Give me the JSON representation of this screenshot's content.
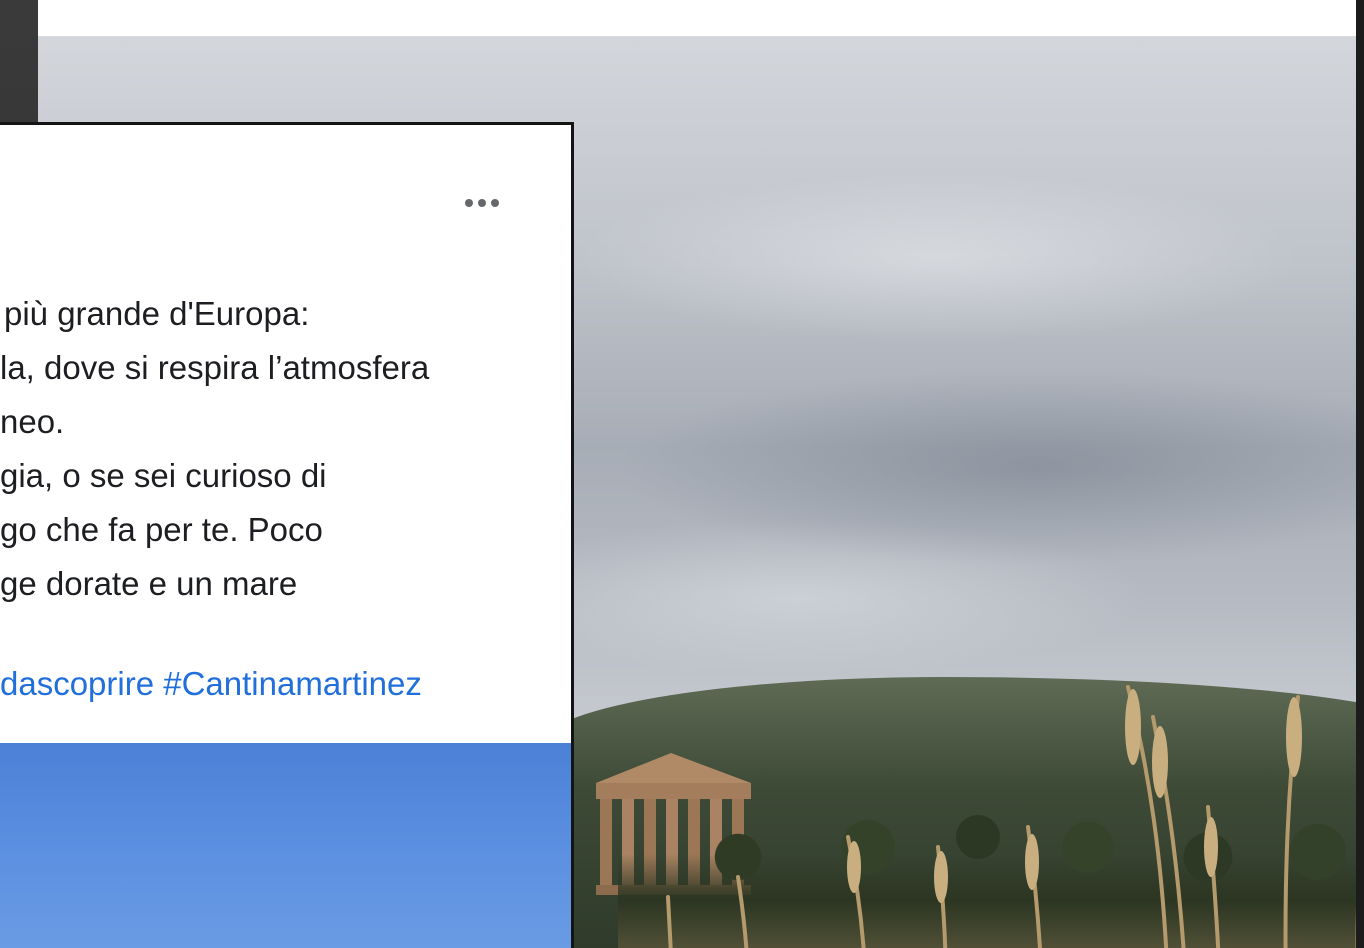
{
  "post": {
    "more_icon": "more-horizontal-icon",
    "lines": [
      "più grande d'Europa:",
      "la, dove si respira l’atmosfera",
      "neo.",
      "gia, o se sei curioso di",
      "go che fa per te. Poco",
      "ge dorate e un mare"
    ],
    "hashtag_1": "dascoprire",
    "hashtag_2": "#Cantinamartinez"
  },
  "colors": {
    "link": "#216fdb",
    "text": "#1c1e21",
    "photo_sky": "#5b8fe0"
  }
}
